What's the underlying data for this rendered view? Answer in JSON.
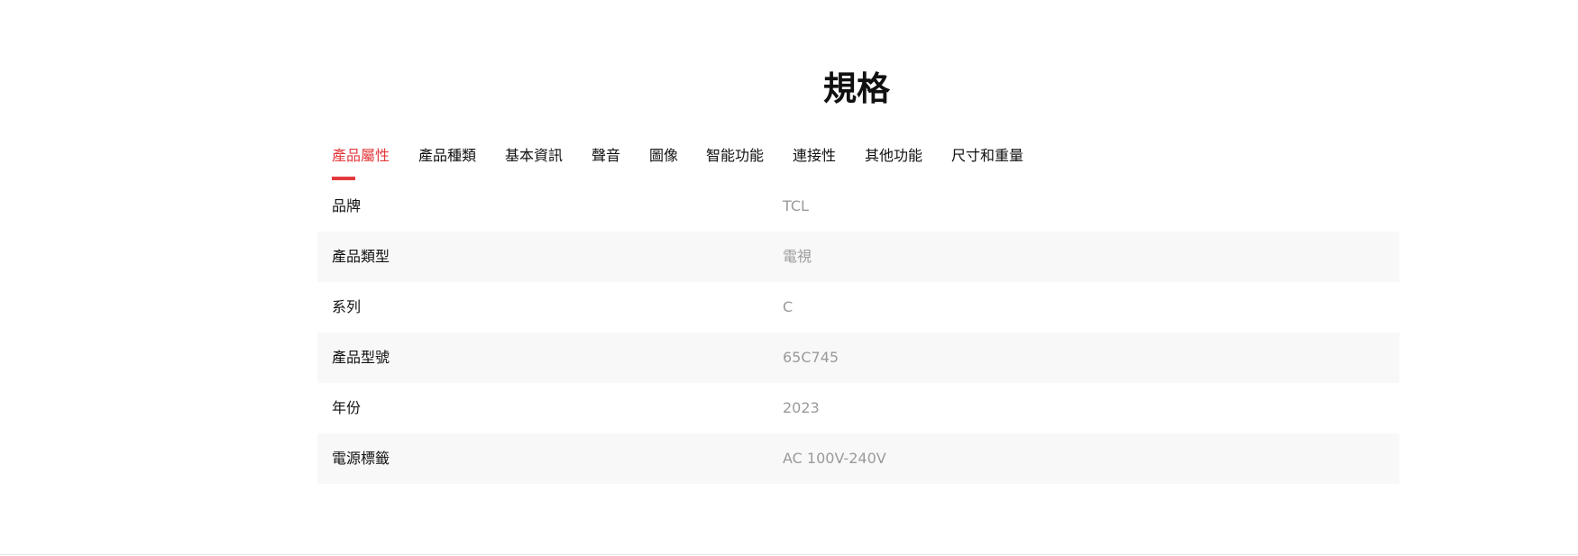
{
  "page_title": "規格",
  "tabs": [
    {
      "label": "產品屬性",
      "active": true
    },
    {
      "label": "產品種類",
      "active": false
    },
    {
      "label": "基本資訊",
      "active": false
    },
    {
      "label": "聲音",
      "active": false
    },
    {
      "label": "圖像",
      "active": false
    },
    {
      "label": "智能功能",
      "active": false
    },
    {
      "label": "連接性",
      "active": false
    },
    {
      "label": "其他功能",
      "active": false
    },
    {
      "label": "尺寸和重量",
      "active": false
    }
  ],
  "specs": [
    {
      "label": "品牌",
      "value": "TCL"
    },
    {
      "label": "產品類型",
      "value": "電視"
    },
    {
      "label": "系列",
      "value": "C"
    },
    {
      "label": "產品型號",
      "value": "65C745"
    },
    {
      "label": "年份",
      "value": "2023"
    },
    {
      "label": "電源標籤",
      "value": "AC 100V-240V"
    }
  ],
  "colors": {
    "accent": "#e4393c",
    "text": "#111111",
    "muted": "#9a9a9a",
    "row_alt": "#f8f8f8"
  }
}
